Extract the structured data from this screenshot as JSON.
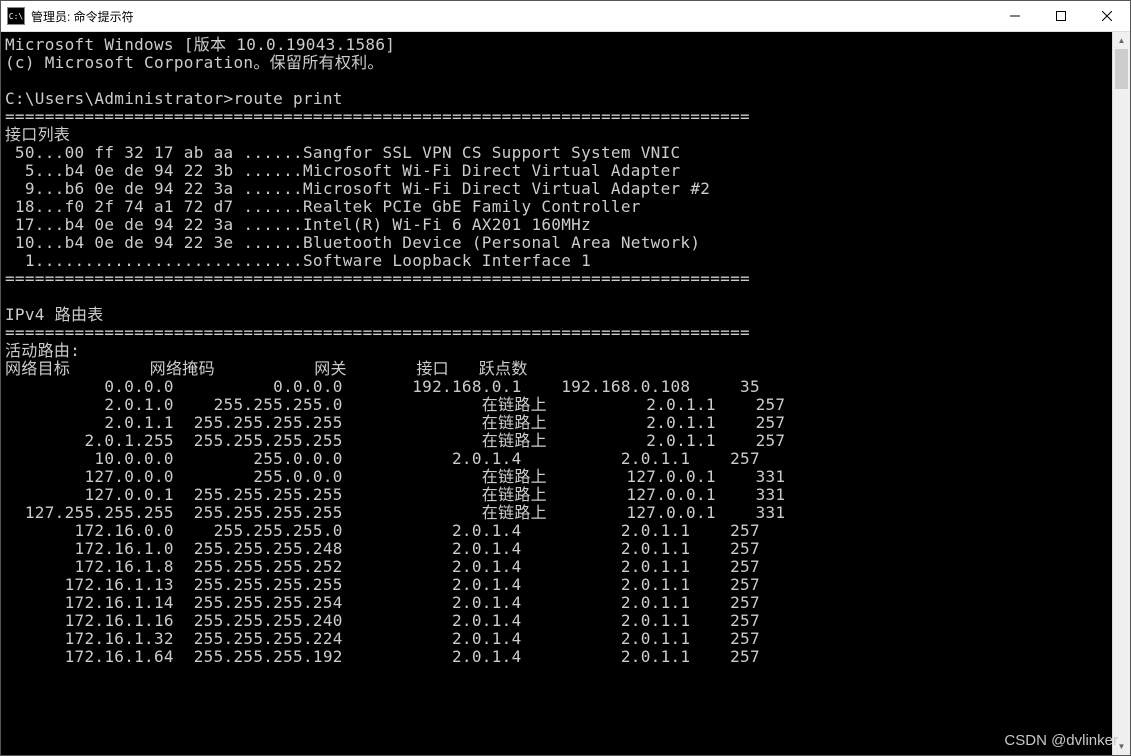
{
  "window": {
    "title": "管理员: 命令提示符"
  },
  "banner_line1": "Microsoft Windows [版本 10.0.19043.1586]",
  "banner_line2": "(c) Microsoft Corporation。保留所有权利。",
  "prompt": "C:\\Users\\Administrator>",
  "command": "route print",
  "sep_iface": "===========================================================================",
  "iface_header": "接口列表",
  "iface_list": [
    " 50...00 ff 32 17 ab aa ......Sangfor SSL VPN CS Support System VNIC",
    "  5...b4 0e de 94 22 3b ......Microsoft Wi-Fi Direct Virtual Adapter",
    "  9...b6 0e de 94 22 3a ......Microsoft Wi-Fi Direct Virtual Adapter #2",
    " 18...f0 2f 74 a1 72 d7 ......Realtek PCIe GbE Family Controller",
    " 17...b4 0e de 94 22 3a ......Intel(R) Wi-Fi 6 AX201 160MHz",
    " 10...b4 0e de 94 22 3e ......Bluetooth Device (Personal Area Network)",
    "  1...........................Software Loopback Interface 1"
  ],
  "ipv4_title": "IPv4 路由表",
  "active_routes": "活动路由:",
  "route_header": "网络目标        网络掩码          网关       接口   跃点数",
  "routes": [
    {
      "dest": "0.0.0.0",
      "mask": "0.0.0.0",
      "gateway": "192.168.0.1",
      "iface": "192.168.0.108",
      "metric": "35"
    },
    {
      "dest": "2.0.1.0",
      "mask": "255.255.255.0",
      "gateway": "在链路上",
      "iface": "2.0.1.1",
      "metric": "257"
    },
    {
      "dest": "2.0.1.1",
      "mask": "255.255.255.255",
      "gateway": "在链路上",
      "iface": "2.0.1.1",
      "metric": "257"
    },
    {
      "dest": "2.0.1.255",
      "mask": "255.255.255.255",
      "gateway": "在链路上",
      "iface": "2.0.1.1",
      "metric": "257"
    },
    {
      "dest": "10.0.0.0",
      "mask": "255.0.0.0",
      "gateway": "2.0.1.4",
      "iface": "2.0.1.1",
      "metric": "257"
    },
    {
      "dest": "127.0.0.0",
      "mask": "255.0.0.0",
      "gateway": "在链路上",
      "iface": "127.0.0.1",
      "metric": "331"
    },
    {
      "dest": "127.0.0.1",
      "mask": "255.255.255.255",
      "gateway": "在链路上",
      "iface": "127.0.0.1",
      "metric": "331"
    },
    {
      "dest": "127.255.255.255",
      "mask": "255.255.255.255",
      "gateway": "在链路上",
      "iface": "127.0.0.1",
      "metric": "331"
    },
    {
      "dest": "172.16.0.0",
      "mask": "255.255.255.0",
      "gateway": "2.0.1.4",
      "iface": "2.0.1.1",
      "metric": "257"
    },
    {
      "dest": "172.16.1.0",
      "mask": "255.255.255.248",
      "gateway": "2.0.1.4",
      "iface": "2.0.1.1",
      "metric": "257"
    },
    {
      "dest": "172.16.1.8",
      "mask": "255.255.255.252",
      "gateway": "2.0.1.4",
      "iface": "2.0.1.1",
      "metric": "257"
    },
    {
      "dest": "172.16.1.13",
      "mask": "255.255.255.255",
      "gateway": "2.0.1.4",
      "iface": "2.0.1.1",
      "metric": "257"
    },
    {
      "dest": "172.16.1.14",
      "mask": "255.255.255.254",
      "gateway": "2.0.1.4",
      "iface": "2.0.1.1",
      "metric": "257"
    },
    {
      "dest": "172.16.1.16",
      "mask": "255.255.255.240",
      "gateway": "2.0.1.4",
      "iface": "2.0.1.1",
      "metric": "257"
    },
    {
      "dest": "172.16.1.32",
      "mask": "255.255.255.224",
      "gateway": "2.0.1.4",
      "iface": "2.0.1.1",
      "metric": "257"
    },
    {
      "dest": "172.16.1.64",
      "mask": "255.255.255.192",
      "gateway": "2.0.1.4",
      "iface": "2.0.1.1",
      "metric": "257"
    }
  ],
  "watermark": "CSDN @dvlinker"
}
